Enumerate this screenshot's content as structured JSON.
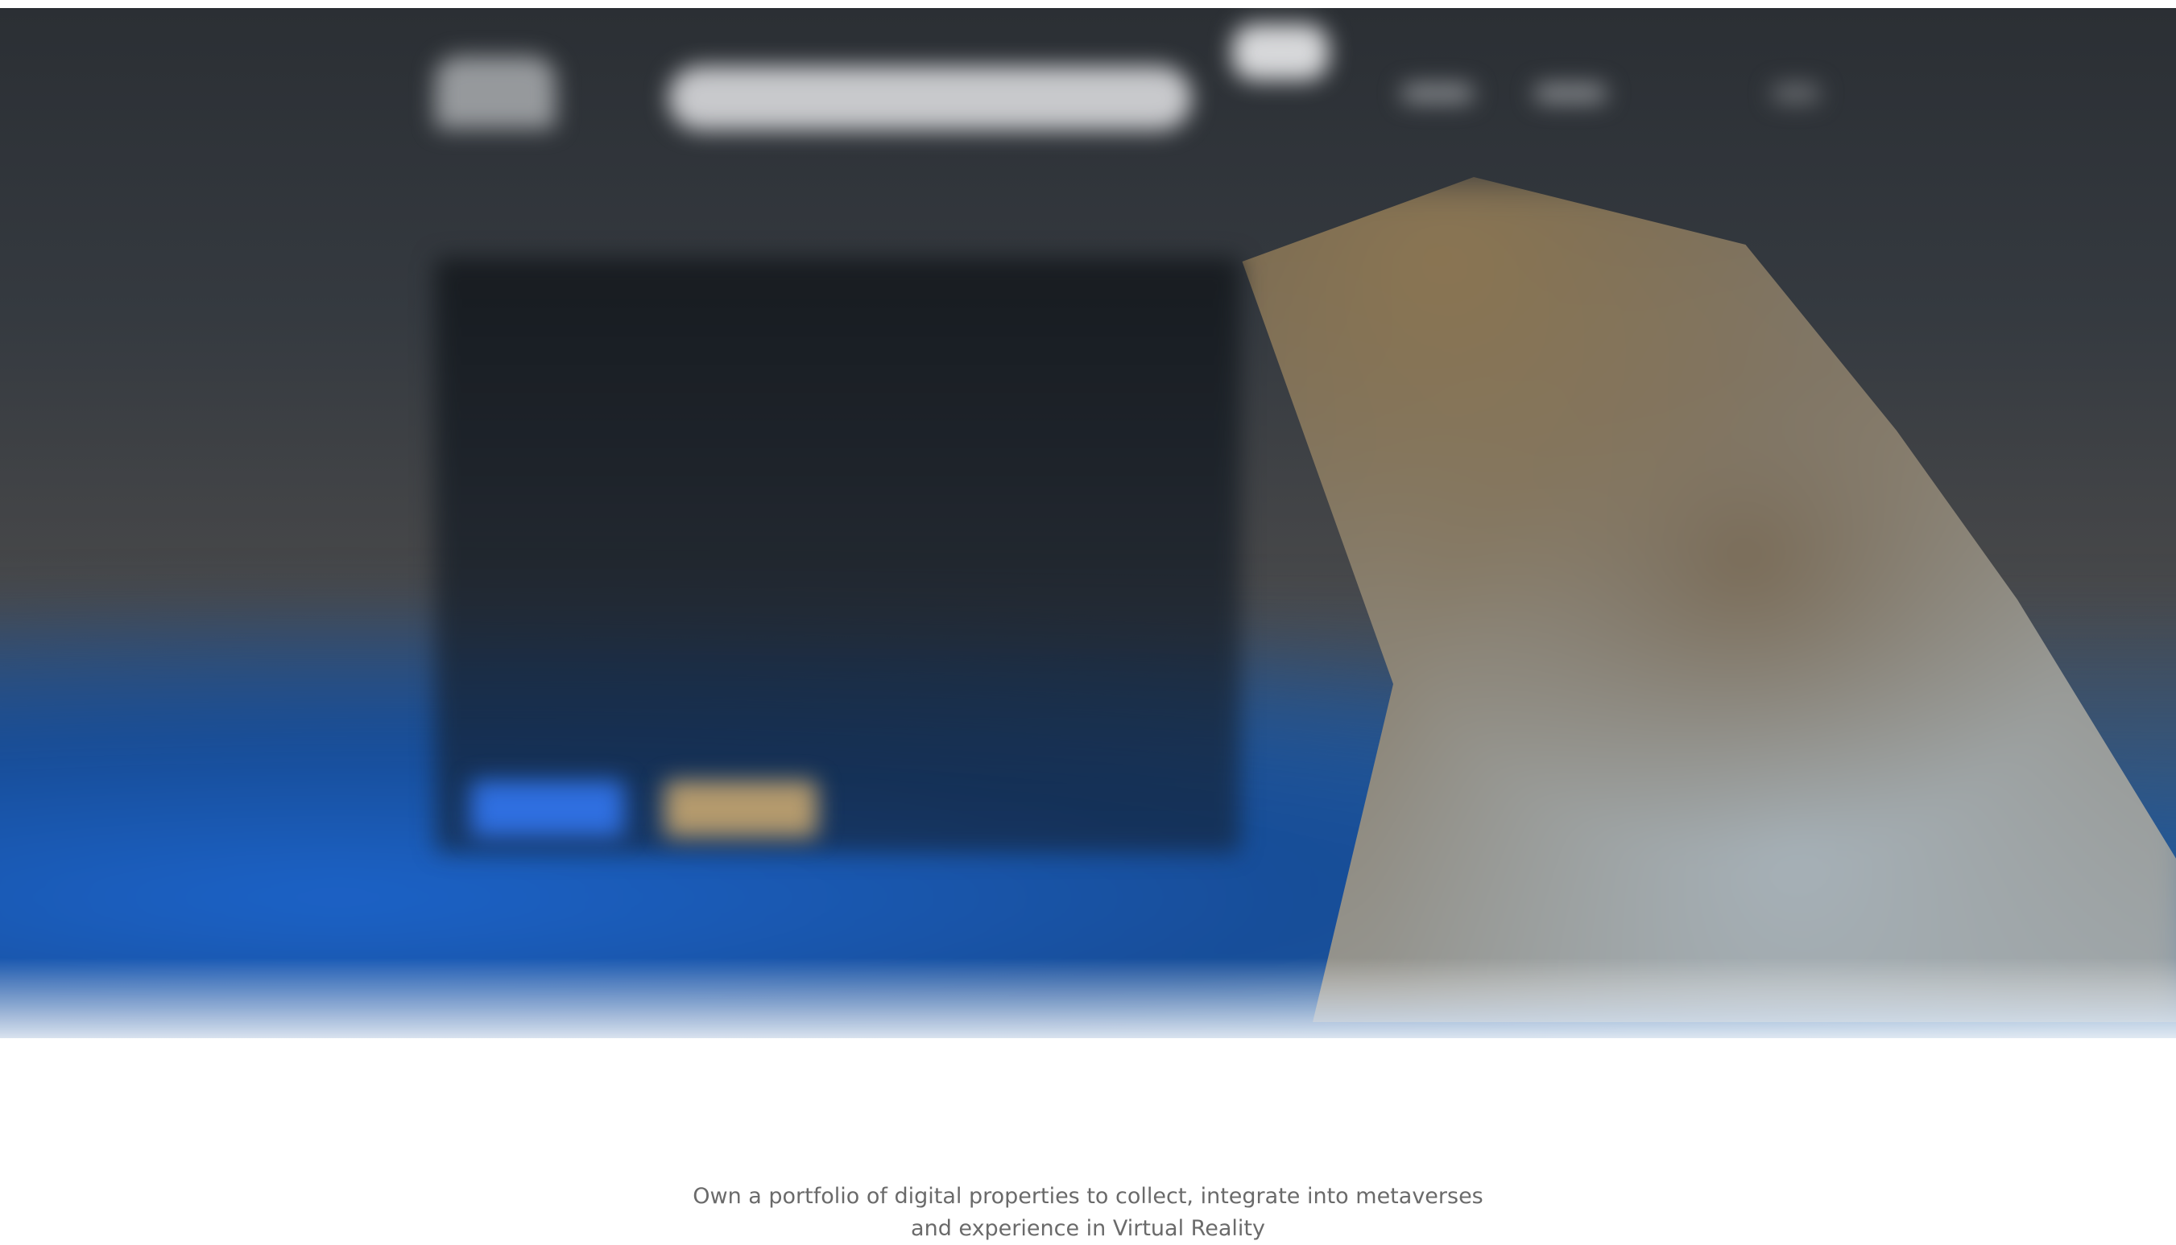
{
  "header": {
    "logo_name": "logo",
    "search": {
      "placeholder": "",
      "value": ""
    },
    "nav": {
      "items": [
        "",
        "",
        ""
      ]
    }
  },
  "hero": {
    "title": "",
    "subtitle": "",
    "primary_button_label": "",
    "secondary_button_label": ""
  },
  "intro": {
    "heading": "",
    "subheading": "Own a portfolio of digital properties to collect, integrate into metaverses and experience in Virtual Reality"
  },
  "colors": {
    "hero_top": "#2b2f34",
    "accent_blue": "#2f6fe0",
    "accent_gold": "#b49a6d",
    "text_muted": "#6a6a6a"
  }
}
